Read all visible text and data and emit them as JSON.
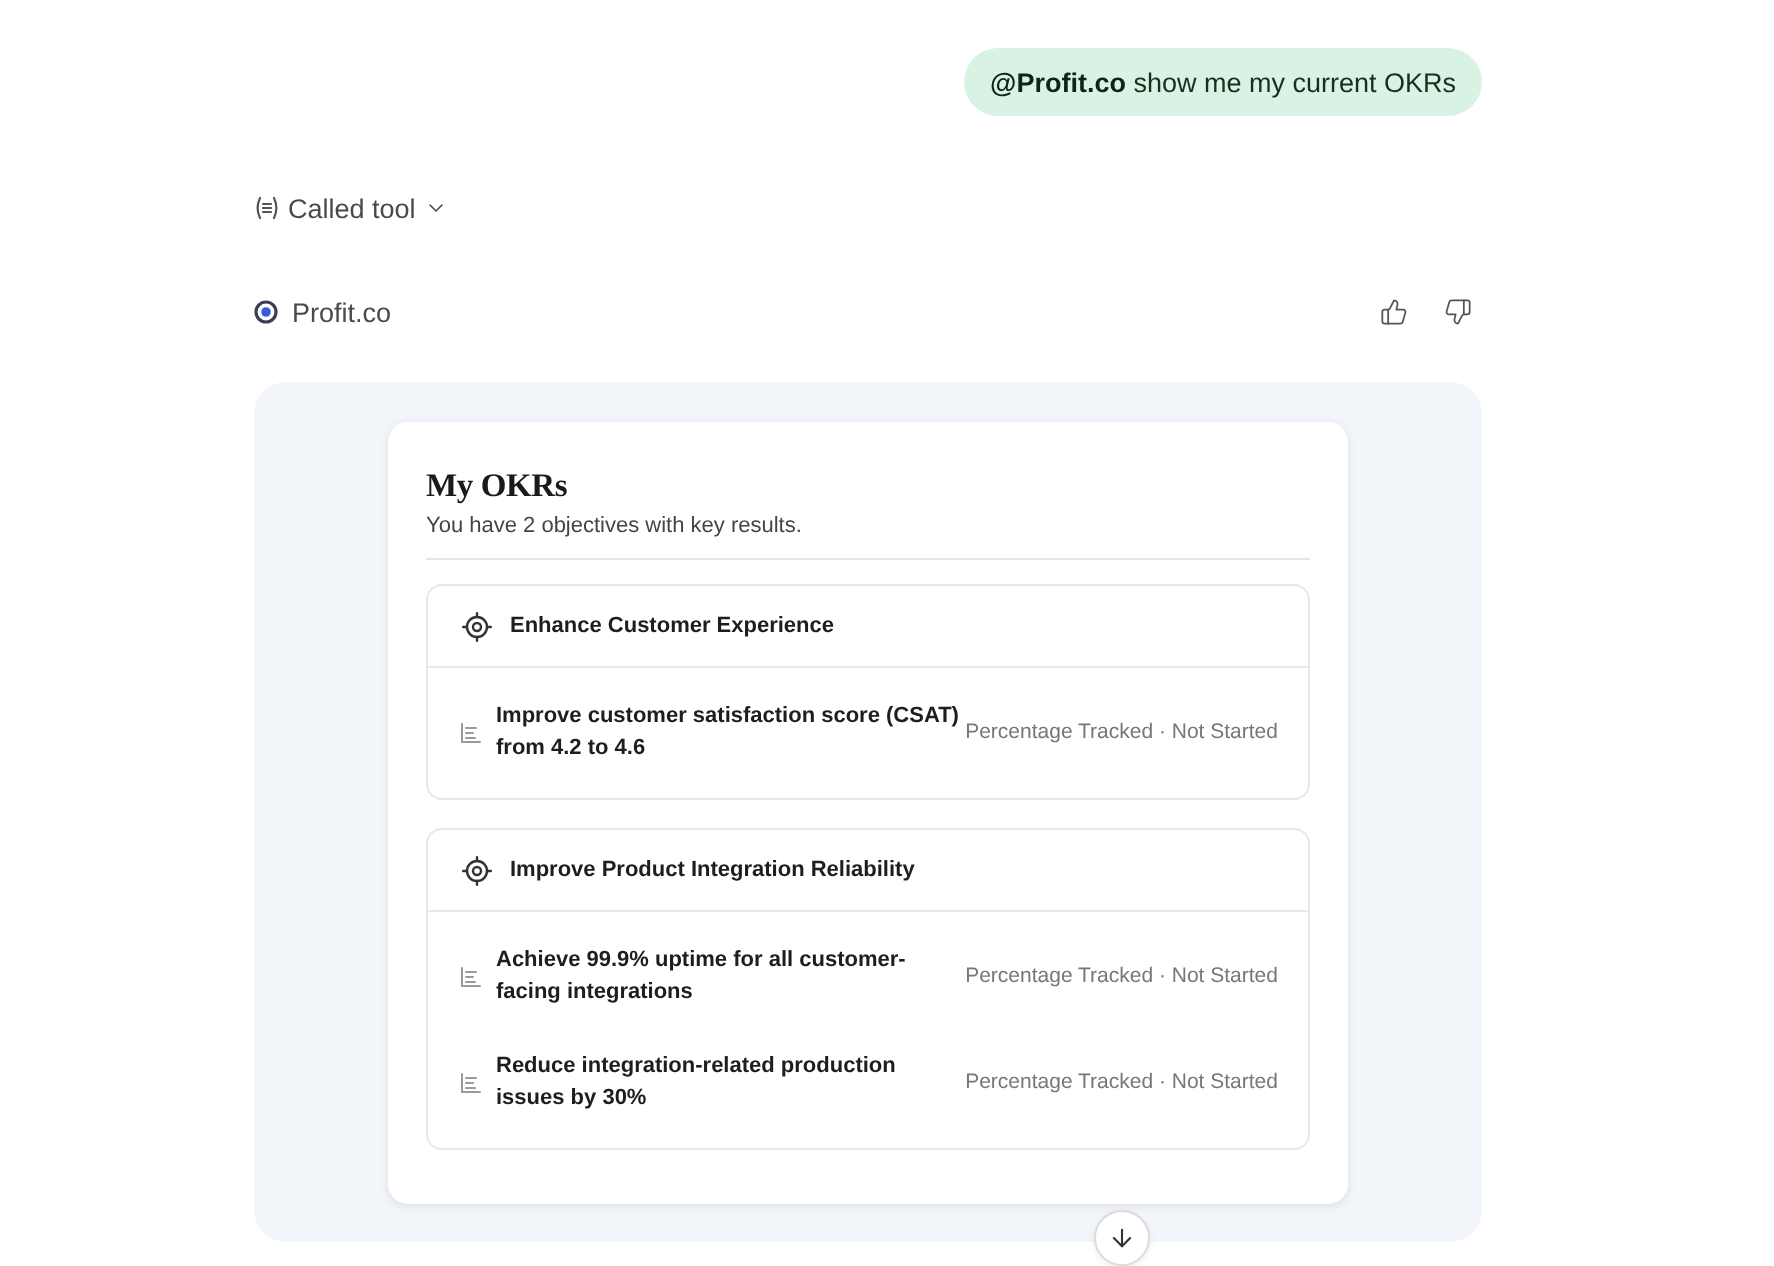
{
  "user_message": {
    "text": "**@Profit.co** show me my current OKRs"
  },
  "tool_call": {
    "label": "Called tool",
    "expanded": false
  },
  "assistant": {
    "name": "Profit.co"
  },
  "okr_card": {
    "title": "My OKRs",
    "subtitle": "You have 2 objectives with key results.",
    "objectives": [
      {
        "title": "Enhance Customer Experience",
        "key_results": [
          {
            "title": "Improve customer satisfaction score (CSAT) from 4.2 to 4.6",
            "status": "Percentage Tracked · Not Started"
          }
        ]
      },
      {
        "title": "Improve Product Integration Reliability",
        "key_results": [
          {
            "title": "Achieve 99.9% uptime for all customer-facing integrations",
            "status": "Percentage Tracked · Not Started"
          },
          {
            "title": "Reduce integration-related production issues by 30%",
            "status": "Percentage Tracked · Not Started"
          }
        ]
      }
    ]
  }
}
